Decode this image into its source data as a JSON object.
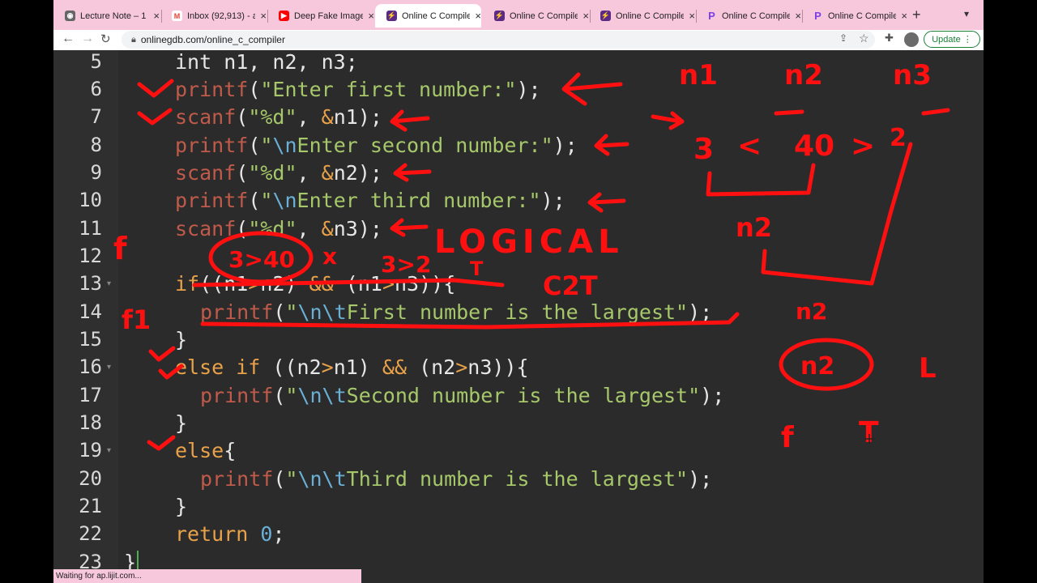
{
  "tabs": [
    {
      "title": "Lecture Note – 1",
      "icon": "globe-icon",
      "color": "#555555",
      "active": false
    },
    {
      "title": "Inbox (92,913) - a",
      "icon": "gmail-icon",
      "color": "#ea4335",
      "active": false
    },
    {
      "title": "Deep Fake Image",
      "icon": "youtube-icon",
      "color": "#ff0000",
      "active": false
    },
    {
      "title": "Online C Compiler",
      "icon": "onlinegdb-icon",
      "color": "#5b2a86",
      "active": true
    },
    {
      "title": "Online C Compiler",
      "icon": "onlinegdb-icon",
      "color": "#5b2a86",
      "active": false
    },
    {
      "title": "Online C Compiler",
      "icon": "onlinegdb-icon",
      "color": "#5b2a86",
      "active": false
    },
    {
      "title": "Online C Compiler",
      "icon": "p-icon",
      "color": "#7b3fe4",
      "active": false
    },
    {
      "title": "Online C Compiler",
      "icon": "p-icon",
      "color": "#7b3fe4",
      "active": false
    }
  ],
  "toolbar": {
    "url": "onlinegdb.com/online_c_compiler",
    "update_label": "Update"
  },
  "editor": {
    "line_numbers": [
      "5",
      "6",
      "7",
      "8",
      "9",
      "10",
      "11",
      "12",
      "13",
      "14",
      "15",
      "16",
      "17",
      "18",
      "19",
      "20",
      "21",
      "22",
      "23"
    ],
    "fold_marks": [
      "13",
      "16",
      "19"
    ]
  },
  "code_tokens": {
    "l5": [
      "int n1, n2, n3;"
    ],
    "l6": [
      "printf",
      "(",
      "\"Enter first number:\"",
      ");"
    ],
    "l7": [
      "scanf",
      "(",
      "\"%d\"",
      ", ",
      "&",
      "n1);"
    ],
    "l8": [
      "printf",
      "(",
      "\"",
      "\\n",
      "Enter second number:\"",
      ");"
    ],
    "l9": [
      "scanf",
      "(",
      "\"%d\"",
      ", ",
      "&",
      "n2);"
    ],
    "l10": [
      "printf",
      "(",
      "\"",
      "\\n",
      "Enter third number:\"",
      ");"
    ],
    "l11": [
      "scanf",
      "(",
      "\"%d\"",
      ", ",
      "&",
      "n3);"
    ],
    "l13": [
      "if",
      "((n1",
      ">",
      "n2) ",
      "&&",
      " (n1",
      ">",
      "n3)){"
    ],
    "l14": [
      "printf",
      "(",
      "\"",
      "\\n\\t",
      "First number is the largest\"",
      ");"
    ],
    "l15": [
      "}"
    ],
    "l16": [
      "else if",
      " ((n2",
      ">",
      "n1) ",
      "&&",
      " (n2",
      ">",
      "n3)){"
    ],
    "l17": [
      "printf",
      "(",
      "\"",
      "\\n\\t",
      "Second number is the largest\"",
      ");"
    ],
    "l18": [
      "}"
    ],
    "l19": [
      "else",
      "{"
    ],
    "l20": [
      "printf",
      "(",
      "\"",
      "\\n\\t",
      "Third number is the largest\"",
      ");"
    ],
    "l21": [
      "}"
    ],
    "l22": [
      "return",
      " ",
      "0",
      ";"
    ],
    "l23": [
      "}"
    ]
  },
  "annotations": {
    "n1": "n1",
    "n2": "n2",
    "n3": "n3",
    "v1": "3",
    "lt": "<",
    "v2": "40",
    "gt": ">",
    "v3": "2",
    "n2_mid": "n2",
    "n2_low": "n2",
    "n2_circled": "n2",
    "L": "L",
    "f": "f",
    "T": "T",
    "f_left": "f",
    "circled_expr": "3>40",
    "x": "x",
    "expr2": "3>2",
    "logical": "LOGICAL",
    "t_small": "T",
    "cond": "C2T",
    "f1": "f1"
  },
  "status_text": "Waiting for ap.lijit.com..."
}
